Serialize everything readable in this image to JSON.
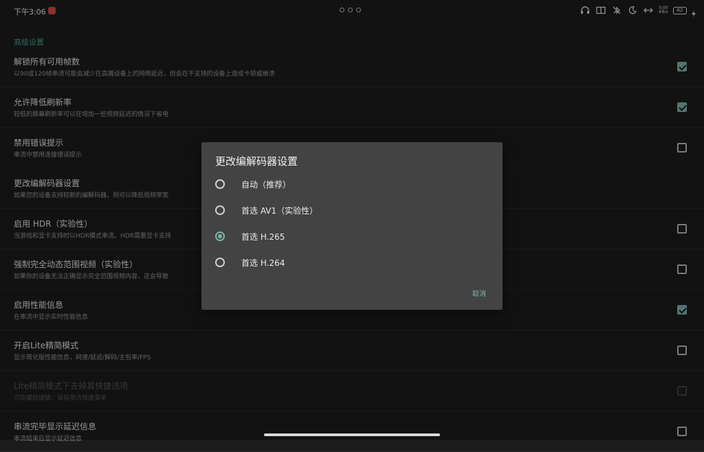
{
  "status_bar": {
    "time": "下午3:06",
    "network_speed_line1": "0.00",
    "network_speed_line2": "KB/s",
    "battery": "82"
  },
  "settings": {
    "section_title": "高级设置",
    "rows": [
      {
        "title": "解锁所有可用帧数",
        "subtitle": "以90或120帧串流可能会减少在高端设备上的网络延迟，但会在不支持的设备上造成卡顿或崩溃",
        "checked": true,
        "disabled": false
      },
      {
        "title": "允许降低刷新率",
        "subtitle": "较低的屏幕刷新率可以在增加一些视频延迟的情况下省电",
        "checked": true,
        "disabled": false
      },
      {
        "title": "禁用错误提示",
        "subtitle": "串流中禁用连接错误提示",
        "checked": false,
        "disabled": false
      },
      {
        "title": "更改编解码器设置",
        "subtitle": "如果您的设备支持较新的编解码器，则可以降低视频带宽",
        "checked": null,
        "disabled": false
      },
      {
        "title": "启用 HDR（实验性）",
        "subtitle": "当游戏和显卡支持时以HDR模式串流。HDR需要显卡支持",
        "checked": false,
        "disabled": false
      },
      {
        "title": "强制完全动态范围视频（实验性）",
        "subtitle": "如果你的设备无法正确显示完全范围视频内容，这会导致",
        "checked": false,
        "disabled": false
      },
      {
        "title": "启用性能信息",
        "subtitle": "在串流中显示实时性能信息",
        "checked": true,
        "disabled": false
      },
      {
        "title": "开启Lite精简模式",
        "subtitle": "显示简化版性能信息，网速/延迟/解码/主包率/FPS",
        "checked": false,
        "disabled": false
      },
      {
        "title": "Lite精简模式下去掉其快捷选项",
        "subtitle": "可隐藏快捷键，保留简洁快捷菜单",
        "checked": false,
        "disabled": true
      },
      {
        "title": "串流完毕显示延迟信息",
        "subtitle": "串流结束后显示延迟信息",
        "checked": false,
        "disabled": false
      }
    ]
  },
  "dialog": {
    "title": "更改编解码器设置",
    "options": [
      {
        "label": "自动（推荐）",
        "selected": false
      },
      {
        "label": "首选 AV1（实验性）",
        "selected": false
      },
      {
        "label": "首选 H.265",
        "selected": true
      },
      {
        "label": "首选 H.264",
        "selected": false
      }
    ],
    "cancel_label": "取消"
  },
  "colors": {
    "accent": "#7fb3ac",
    "background": "#1c1c1c",
    "dialog": "#434343"
  }
}
